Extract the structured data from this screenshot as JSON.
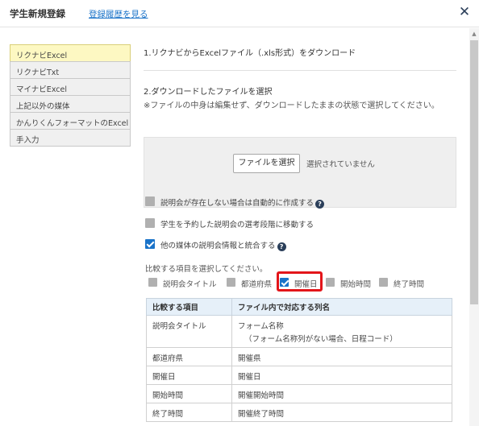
{
  "header": {
    "title": "学生新規登録",
    "history_link": "登録履歴を見る",
    "close_glyph": "✕"
  },
  "sidebar": {
    "items": [
      {
        "label": "リクナビExcel",
        "active": true
      },
      {
        "label": "リクナビTxt",
        "active": false
      },
      {
        "label": "マイナビExcel",
        "active": false
      },
      {
        "label": "上記以外の媒体",
        "active": false
      },
      {
        "label": "かんりくんフォーマットのExcel",
        "active": false
      },
      {
        "label": "手入力",
        "active": false
      }
    ]
  },
  "main": {
    "step1": "1.リクナビからExcelファイル（.xls形式）をダウンロード",
    "step2": "2.ダウンロードしたファイルを選択",
    "note": "※ファイルの中身は編集せず、ダウンロードしたままの状態で選択してください。",
    "file_button": "ファイルを選択",
    "file_status": "選択されていません",
    "options": [
      {
        "label": "説明会が存在しない場合は自動的に作成する",
        "checked": false,
        "help": true
      },
      {
        "label": "学生を予約した説明会の選考段階に移動する",
        "checked": false,
        "help": false
      },
      {
        "label": "他の媒体の説明会情報と統合する",
        "checked": true,
        "help": true
      }
    ],
    "help_glyph": "?",
    "compare_title": "比較する項目を選択してください。",
    "compare_items": [
      {
        "label": "説明会タイトル",
        "checked": false
      },
      {
        "label": "都道府県",
        "checked": false
      },
      {
        "label": "開催日",
        "checked": true
      },
      {
        "label": "開始時間",
        "checked": false
      },
      {
        "label": "終了時間",
        "checked": false
      }
    ],
    "table": {
      "headers": [
        "比較する項目",
        "ファイル内で対応する列名"
      ],
      "rows": [
        {
          "item": "説明会タイトル",
          "column": "フォーム名称",
          "column_note": "（フォーム名称列がない場合、日程コード）"
        },
        {
          "item": "都道府県",
          "column": "開催県",
          "column_note": ""
        },
        {
          "item": "開催日",
          "column": "開催日",
          "column_note": ""
        },
        {
          "item": "開始時間",
          "column": "開催開始時間",
          "column_note": ""
        },
        {
          "item": "終了時間",
          "column": "開催終了時間",
          "column_note": ""
        }
      ]
    }
  },
  "colors": {
    "accent": "#1a73c9",
    "highlight": "#e3151a",
    "sidebar_active": "#fdf8c2",
    "table_header": "#e6f0f9"
  }
}
